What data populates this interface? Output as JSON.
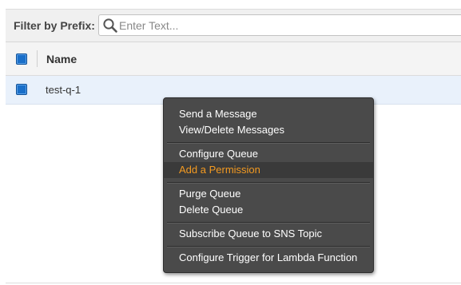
{
  "filter": {
    "label": "Filter by Prefix:",
    "placeholder": "Enter Text...",
    "value": ""
  },
  "table": {
    "columns": [
      "Name"
    ],
    "rows": [
      {
        "name": "test-q-1",
        "selected": true
      }
    ]
  },
  "context_menu": {
    "items": [
      {
        "label": "Send a Message",
        "highlighted": false
      },
      {
        "label": "View/Delete Messages",
        "highlighted": false
      },
      {
        "label": "Configure Queue",
        "highlighted": false
      },
      {
        "label": "Add a Permission",
        "highlighted": true
      },
      {
        "label": "Purge Queue",
        "highlighted": false
      },
      {
        "label": "Delete Queue",
        "highlighted": false
      },
      {
        "label": "Subscribe Queue to SNS Topic",
        "highlighted": false
      },
      {
        "label": "Configure Trigger for Lambda Function",
        "highlighted": false
      }
    ]
  },
  "colors": {
    "checkbox": "#1a6fc9",
    "menu_background": "#4a4a4a",
    "menu_highlight_text": "#f39a21",
    "selected_row": "#e9f1fb"
  },
  "icons": {
    "search": "search-icon",
    "checkbox": "checkbox-checked-icon"
  }
}
